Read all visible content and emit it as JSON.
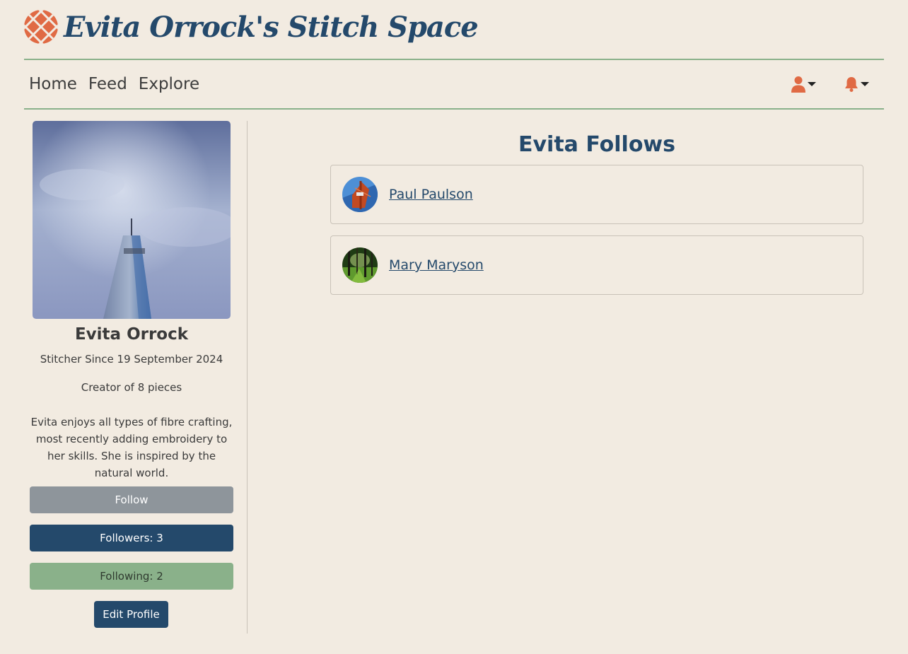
{
  "header": {
    "site_title": "Evita Orrock's Stitch Space",
    "brand_color": "#24496b",
    "accent_color": "#e06a44"
  },
  "nav": {
    "links": [
      "Home",
      "Feed",
      "Explore"
    ],
    "icons": [
      "user-icon",
      "bell-icon"
    ]
  },
  "profile": {
    "name": "Evita Orrock",
    "since": "Stitcher Since 19 September 2024",
    "creator": "Creator of 8 pieces",
    "bio": "Evita enjoys all types of fibre crafting, most recently adding embroidery to her skills. She is inspired by the natural world.",
    "follow_label": "Follow",
    "followers_label": "Followers: 3",
    "following_label": "Following: 2",
    "edit_label": "Edit Profile"
  },
  "main": {
    "title": "Evita Follows",
    "follows": [
      {
        "name": "Paul Paulson"
      },
      {
        "name": "Mary Maryson"
      }
    ]
  }
}
